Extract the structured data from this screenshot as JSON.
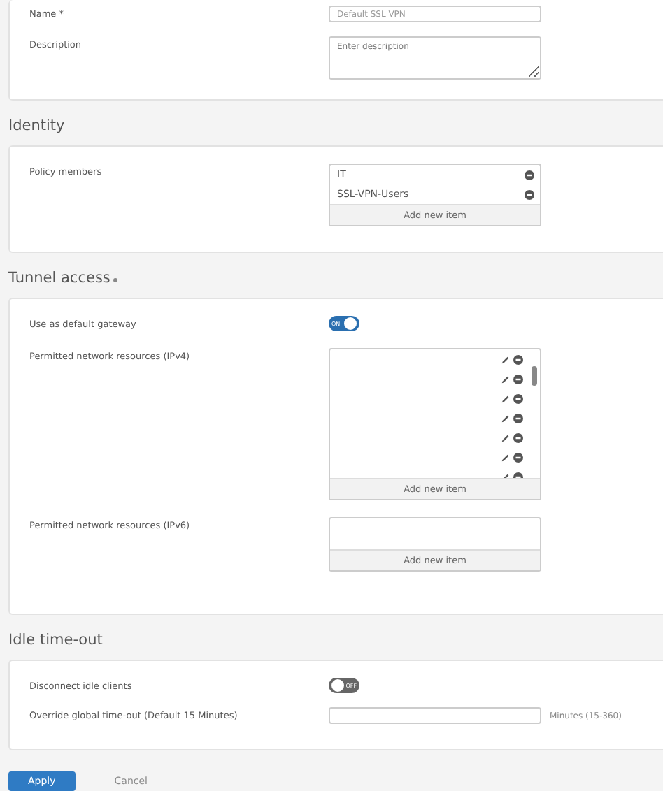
{
  "general": {
    "fields": [
      {
        "kind": "text",
        "label": "Name *",
        "value": "Default SSL VPN"
      },
      {
        "kind": "textarea",
        "label": "Description",
        "placeholder": "Enter description"
      }
    ]
  },
  "sections": [
    {
      "title": "Identity",
      "fields": [
        {
          "kind": "list",
          "label": "Policy members",
          "items": [
            "IT",
            "SSL-VPN-Users"
          ],
          "add_label": "Add new item"
        }
      ]
    },
    {
      "title": "Tunnel access",
      "required": true,
      "fields": [
        {
          "kind": "toggle",
          "label": "Use as default gateway",
          "on": true,
          "toggle_text": "ON"
        },
        {
          "kind": "scrolllist",
          "label": "Permitted network resources (IPv4)",
          "add_label": "Add new item"
        },
        {
          "kind": "list",
          "label": "Permitted network resources (IPv6)",
          "add_label": "Add new item"
        }
      ]
    },
    {
      "title": "Idle time-out",
      "fields": [
        {
          "kind": "toggle",
          "label": "Disconnect idle clients",
          "on": false,
          "toggle_text": "OFF"
        },
        {
          "kind": "text",
          "label": "Override global time-out (Default 15 Minutes)",
          "suffix": "Minutes (15-360)"
        }
      ]
    }
  ],
  "buttons": [
    {
      "label": "Apply",
      "primary": true
    },
    {
      "label": "Cancel",
      "primary": false
    }
  ]
}
